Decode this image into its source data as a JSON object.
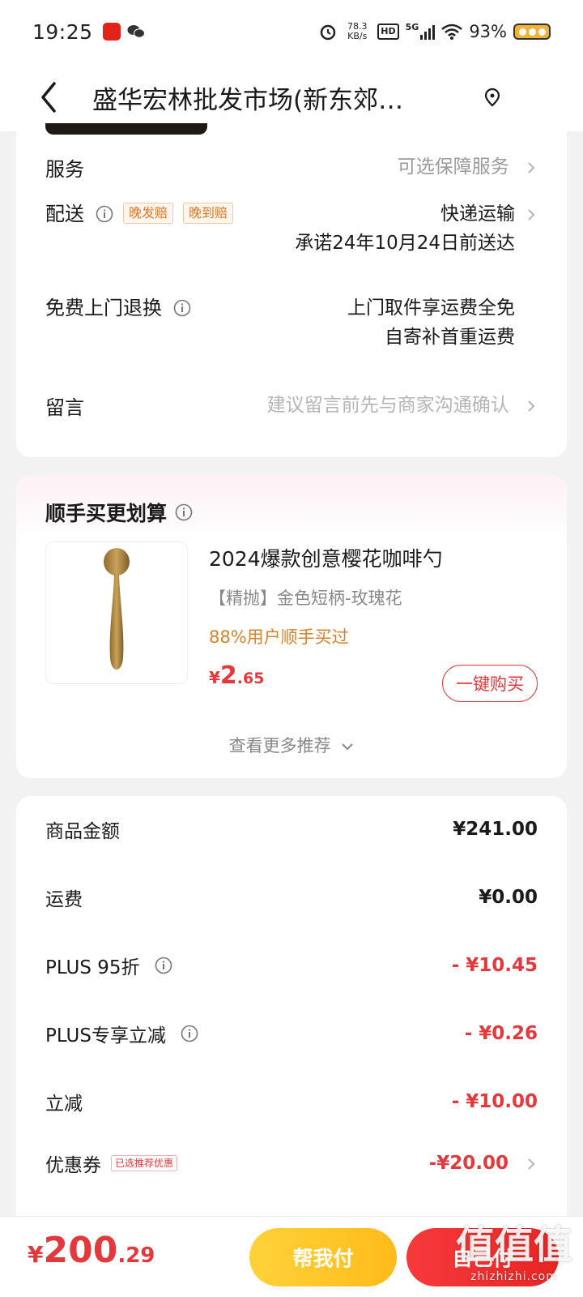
{
  "status_bar": {
    "time": "19:25",
    "net_speed": "78.3",
    "net_unit": "KB/s",
    "hd": "HD",
    "network": "5G",
    "battery": "93%"
  },
  "header": {
    "title": "盛华宏林批发市场(新东郊…"
  },
  "order_info": {
    "service": {
      "label": "服务",
      "value": "可选保障服务"
    },
    "delivery": {
      "label": "配送",
      "tags": [
        "晚发赔",
        "晚到赔"
      ],
      "method": "快递运输",
      "promise": "承诺24年10月24日前送达"
    },
    "return": {
      "label": "免费上门退换",
      "line1": "上门取件享运费全免",
      "line2": "自寄补首重运费"
    },
    "message": {
      "label": "留言",
      "placeholder": "建议留言前先与商家沟通确认"
    }
  },
  "recommend": {
    "title": "顺手买更划算",
    "product": {
      "name": "2024爆款创意樱花咖啡勺",
      "spec": "【精抛】金色短柄-玫瑰花",
      "social": "88%用户顺手买过",
      "price_currency": "¥",
      "price_int": "2",
      "price_dec": ".65",
      "buy_label": "一键购买"
    },
    "more_label": "查看更多推荐"
  },
  "amounts": {
    "goods": {
      "label": "商品金额",
      "value": "¥241.00"
    },
    "shipping": {
      "label": "运费",
      "value": "¥0.00"
    },
    "plus_discount": {
      "label": "PLUS 95折",
      "value": "- ¥10.45"
    },
    "plus_exclusive": {
      "label": "PLUS专享立减",
      "value": "- ¥0.26"
    },
    "instant": {
      "label": "立减",
      "value": "- ¥10.00"
    },
    "coupon": {
      "label": "优惠券",
      "tag": "已选推荐优惠",
      "value": "-¥20.00"
    }
  },
  "bottom": {
    "total_currency": "¥",
    "total_int": "200",
    "total_dec": ".29",
    "help_pay": "帮我付",
    "self_pay": "自己付"
  },
  "watermark": {
    "text": "值值值",
    "site": "zhizhizhi.com"
  },
  "colors": {
    "accent_red": "#e4393c",
    "accent_orange": "#d9822b",
    "help_yellow": "#ffc72a",
    "background": "#f2f2f2"
  }
}
